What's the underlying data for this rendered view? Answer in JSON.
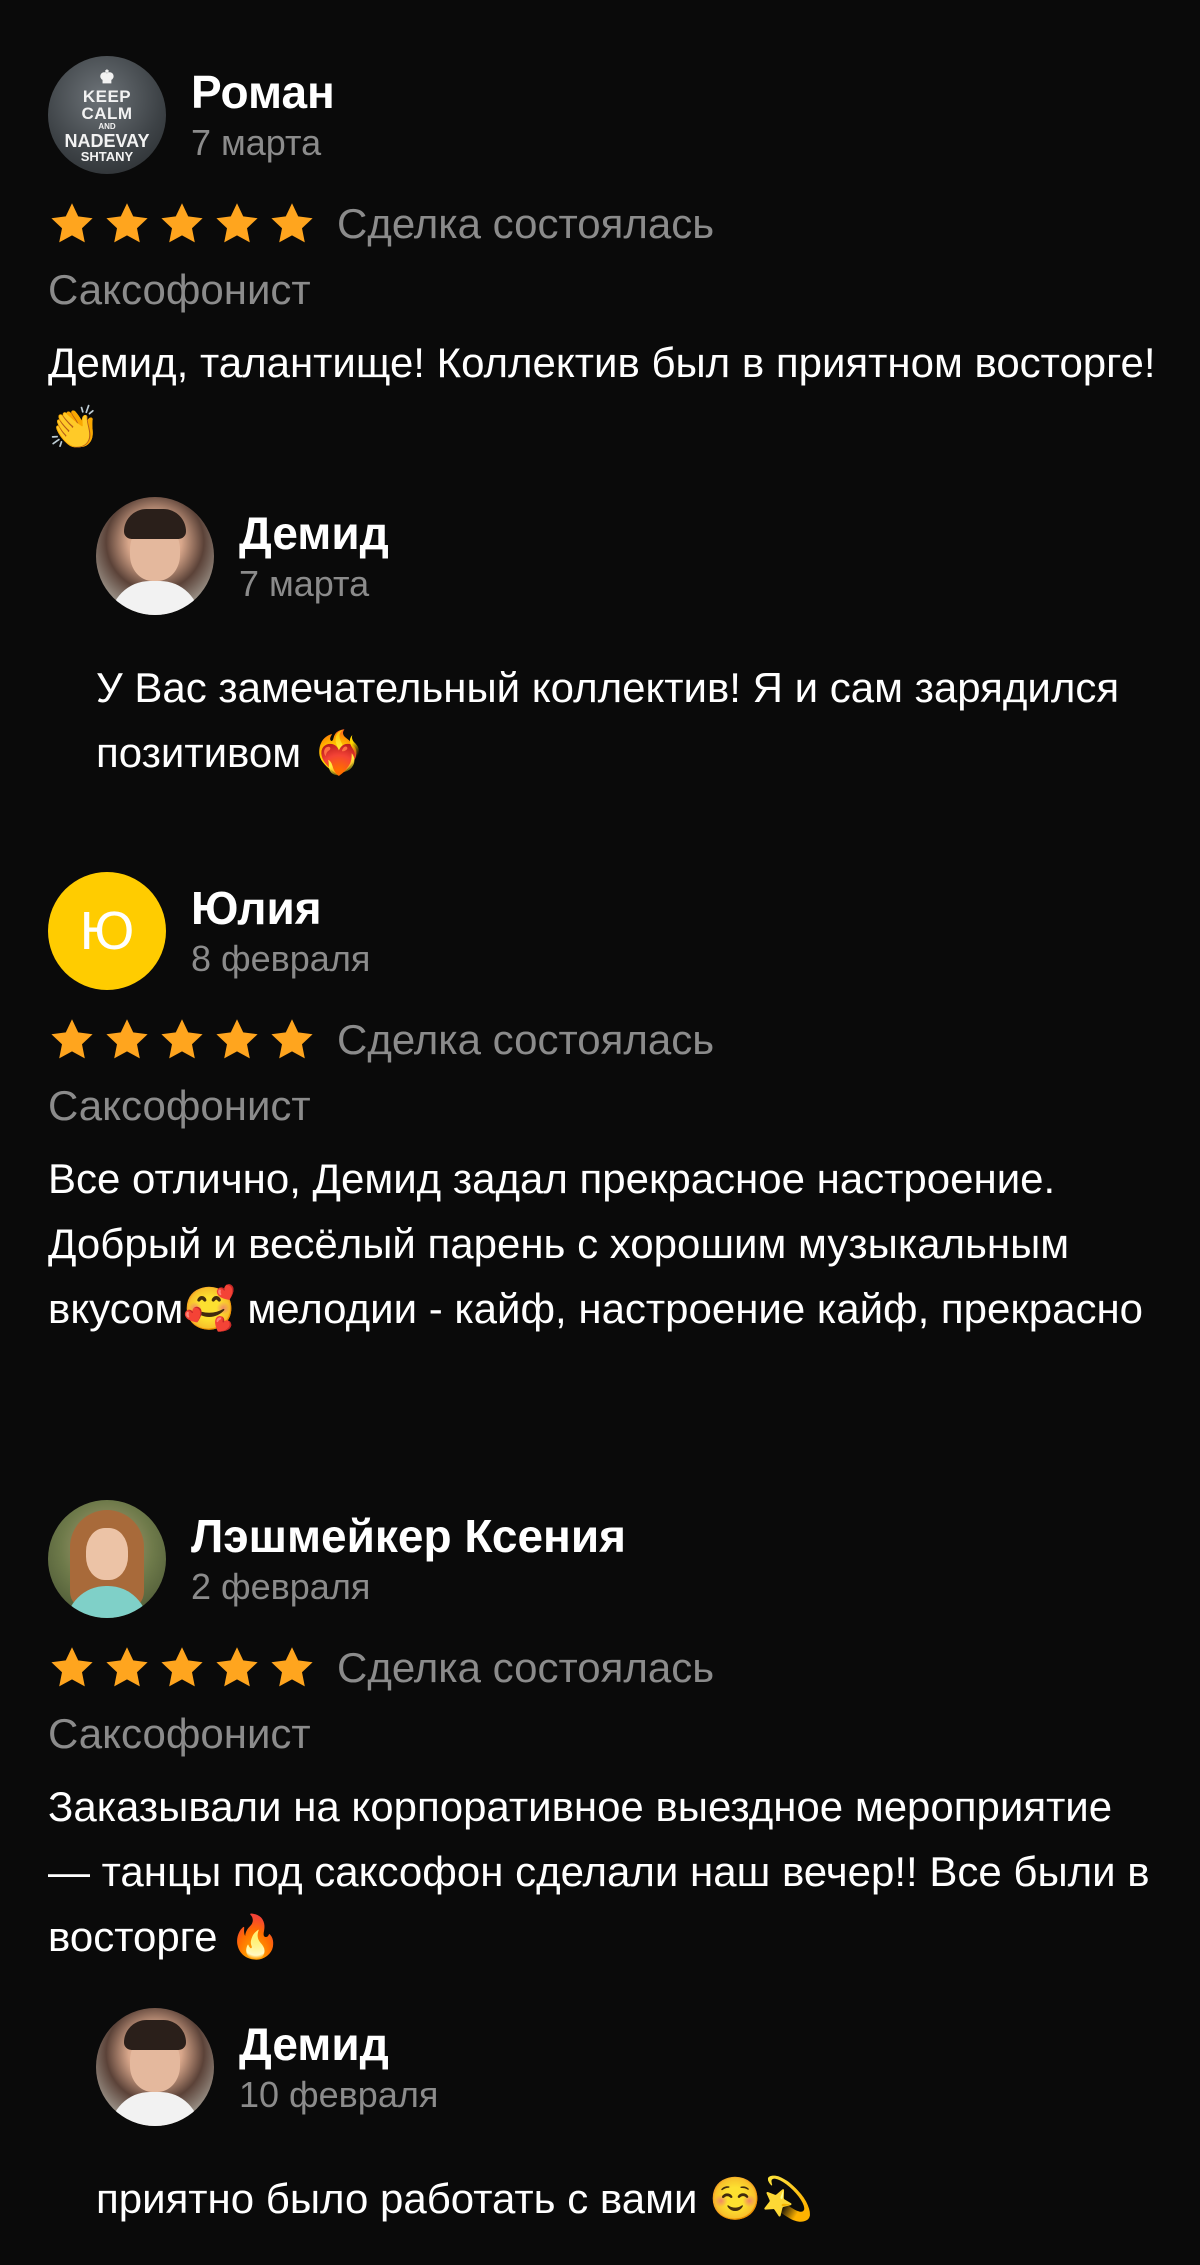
{
  "reviews": [
    {
      "author": "Роман",
      "date": "7 марта",
      "rating": 5,
      "status": "Сделка состоялась",
      "category": "Саксофонист",
      "text": "Демид, талантище! Коллектив был в приятном восторге! 👏",
      "avatar": {
        "type": "image",
        "text_lines": [
          "KEEP",
          "CALM",
          "AND",
          "NADEVAY",
          "SHTANY"
        ]
      },
      "reply": {
        "author": "Демид",
        "date": "7 марта",
        "text": "У Вас замечательный коллектив! Я и сам зарядился позитивом ❤️‍🔥"
      }
    },
    {
      "author": "Юлия",
      "date": "8 февраля",
      "rating": 5,
      "status": "Сделка состоялась",
      "category": "Саксофонист",
      "text": "Все отлично, Демид задал прекрасное настроение. Добрый и весёлый парень с хорошим музыкальным вкусом🥰  мелодии - кайф, настроение кайф, прекрасно",
      "avatar": {
        "type": "letter",
        "letter": "Ю",
        "color": "#ffcc00"
      }
    },
    {
      "author": "Лэшмейкер Ксения",
      "date": "2 февраля",
      "rating": 5,
      "status": "Сделка состоялась",
      "category": "Саксофонист",
      "text": "Заказывали на корпоративное выездное мероприятие — танцы под саксофон сделали наш вечер!! Все были в восторге  🔥",
      "avatar": {
        "type": "photo"
      },
      "reply": {
        "author": "Демид",
        "date": "10 февраля",
        "text": "приятно было работать с вами ☺️💫"
      }
    }
  ],
  "colors": {
    "background": "#0a0a0a",
    "star": "#ffa51e",
    "secondary_text": "#8b8b8b",
    "primary_text": "#ffffff"
  },
  "icons": {
    "rating": "star-icon"
  }
}
